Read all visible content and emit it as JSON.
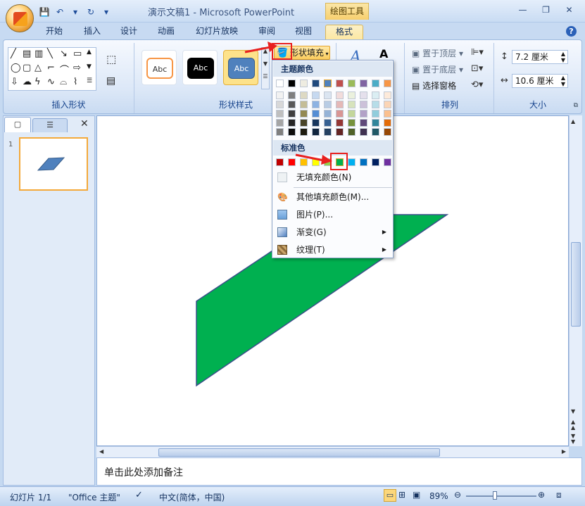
{
  "app": {
    "title": "演示文稿1 - Microsoft PowerPoint",
    "context_tab": "绘图工具"
  },
  "window": {
    "minimize": "—",
    "restore": "❐",
    "close": "✕"
  },
  "tabs": [
    "开始",
    "插入",
    "设计",
    "动画",
    "幻灯片放映",
    "审阅",
    "视图",
    "格式"
  ],
  "ribbon": {
    "groups": {
      "insert_shapes": "插入形状",
      "shape_styles": "形状样式",
      "arrange": "排列",
      "size": "大小"
    },
    "style_samples": [
      "Abc",
      "Abc",
      "Abc"
    ],
    "shape_fill": "形状填充",
    "arrange": {
      "bring_front": "置于顶层",
      "send_back": "置于底层",
      "selection_pane": "选择窗格"
    },
    "size": {
      "height": "7.2 厘米",
      "width": "10.6 厘米"
    }
  },
  "dropdown": {
    "theme_colors_header": "主题颜色",
    "standard_colors_header": "标准色",
    "theme_colors_top": [
      "#ffffff",
      "#000000",
      "#eeece1",
      "#1f497d",
      "#4f81bd",
      "#c0504d",
      "#9bbb59",
      "#8064a2",
      "#4bacc6",
      "#f79646"
    ],
    "theme_shades": [
      [
        "#f2f2f2",
        "#7f7f7f",
        "#ddd9c3",
        "#c6d9f0",
        "#dbe5f1",
        "#f2dcdb",
        "#ebf1dd",
        "#e5e0ec",
        "#dbeef3",
        "#fdeada"
      ],
      [
        "#d8d8d8",
        "#595959",
        "#c4bd97",
        "#8db3e2",
        "#b8cce4",
        "#e5b9b7",
        "#d7e3bc",
        "#ccc1d9",
        "#b7dde8",
        "#fbd5b5"
      ],
      [
        "#bfbfbf",
        "#3f3f3f",
        "#938953",
        "#548dd4",
        "#95b3d7",
        "#d99694",
        "#c3d69b",
        "#b2a2c7",
        "#92cddc",
        "#fac08f"
      ],
      [
        "#a5a5a5",
        "#262626",
        "#494429",
        "#17365d",
        "#366092",
        "#953734",
        "#76923c",
        "#5f497a",
        "#31859b",
        "#e36c09"
      ],
      [
        "#7f7f7f",
        "#0c0c0c",
        "#1d1b10",
        "#0f243e",
        "#244061",
        "#632423",
        "#4f6128",
        "#3f3151",
        "#205867",
        "#974806"
      ]
    ],
    "standard_colors": [
      "#c00000",
      "#ff0000",
      "#ffc000",
      "#ffff00",
      "#92d050",
      "#00b050",
      "#00b0f0",
      "#0070c0",
      "#002060",
      "#7030a0"
    ],
    "items": [
      {
        "label": "无填充颜色(N)",
        "icon": "no-fill-icon"
      },
      {
        "label": "其他填充颜色(M)...",
        "icon": "palette-icon"
      },
      {
        "label": "图片(P)...",
        "icon": "picture-icon"
      },
      {
        "label": "渐变(G)",
        "icon": "gradient-icon",
        "submenu": true
      },
      {
        "label": "纹理(T)",
        "icon": "texture-icon",
        "submenu": true
      }
    ]
  },
  "slide_panel": {
    "slide_number": "1"
  },
  "notes_placeholder": "单击此处添加备注",
  "status": {
    "slide": "幻灯片 1/1",
    "theme": "\"Office 主题\"",
    "language": "中文(简体，中国)",
    "zoom": "89%"
  },
  "shape_color": "#00b050",
  "accent_red": "#e8201f"
}
